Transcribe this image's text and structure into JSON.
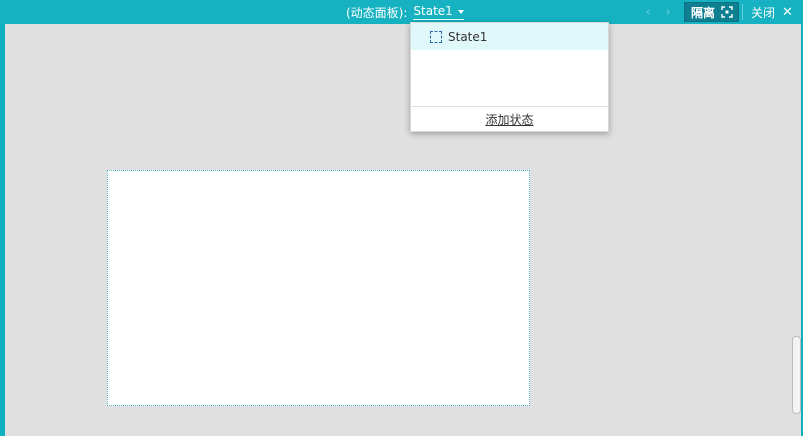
{
  "header": {
    "component_label": "(动态面板):",
    "current_state": "State1",
    "isolate_label": "隔离",
    "close_label": "关闭",
    "close_icon": "close-icon",
    "prev_icon": "chevron-left-icon",
    "next_icon": "chevron-right-icon",
    "isolate_icon": "focus-frame-icon"
  },
  "dropdown": {
    "states": [
      {
        "label": "State1",
        "selected": true
      }
    ],
    "add_state_label": "添加状态"
  },
  "colors": {
    "accent": "#16b2c2",
    "canvas": "#e0e0e0",
    "button_dark": "#0e7f90",
    "selected_item_bg": "#e1f8fa"
  }
}
